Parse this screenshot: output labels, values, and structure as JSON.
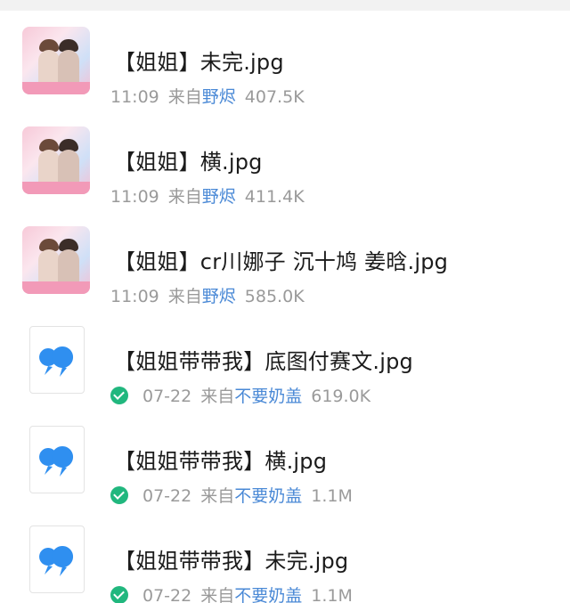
{
  "files": [
    {
      "name": "【姐姐】未完.jpg",
      "time": "11:09",
      "from_prefix": "来自",
      "source": "野烬",
      "size": "407.5K",
      "thumb": "photo",
      "delivered": false
    },
    {
      "name": "【姐姐】横.jpg",
      "time": "11:09",
      "from_prefix": "来自",
      "source": "野烬",
      "size": "411.4K",
      "thumb": "photo",
      "delivered": false
    },
    {
      "name": "【姐姐】cr川娜子 沉十鸠 姜晗.jpg",
      "time": "11:09",
      "from_prefix": "来自",
      "source": "野烬",
      "size": "585.0K",
      "thumb": "photo",
      "delivered": false
    },
    {
      "name": "【姐姐带带我】底图付赛文.jpg",
      "time": "07-22",
      "from_prefix": "来自",
      "source": "不要奶盖",
      "size": "619.0K",
      "thumb": "app-logo",
      "delivered": true
    },
    {
      "name": "【姐姐带带我】横.jpg",
      "time": "07-22",
      "from_prefix": "来自",
      "source": "不要奶盖",
      "size": "1.1M",
      "thumb": "app-logo",
      "delivered": true
    },
    {
      "name": "【姐姐带带我】未完.jpg",
      "time": "07-22",
      "from_prefix": "来自",
      "source": "不要奶盖",
      "size": "1.1M",
      "thumb": "app-logo",
      "delivered": true
    }
  ],
  "colors": {
    "source_link": "#4a89d6",
    "check": "#21b77e",
    "logo_blue": "#2f8ff0"
  }
}
